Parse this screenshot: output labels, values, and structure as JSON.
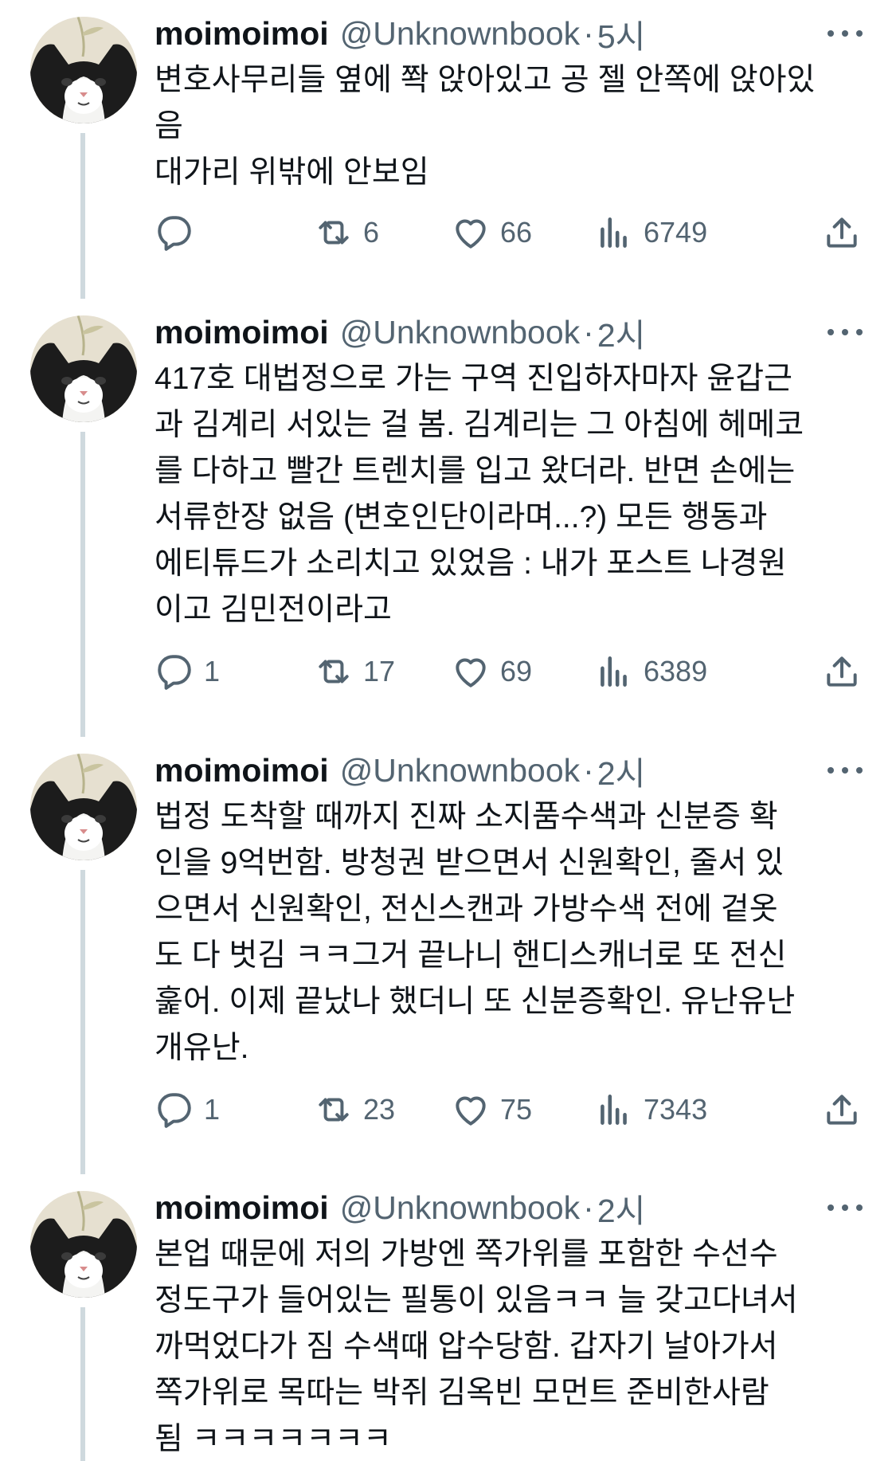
{
  "tweets": [
    {
      "name": "moimoimoi",
      "handle": "@Unknownbook",
      "separator": "·",
      "time": "5시",
      "lines": [
        "변호사무리들 옆에 쫙 앉아있고 공 젤 안쪽에 앉아있",
        "음",
        "대가리 위밖에 안보임"
      ],
      "replies": "",
      "retweets": "6",
      "likes": "66",
      "views": "6749"
    },
    {
      "name": "moimoimoi",
      "handle": "@Unknownbook",
      "separator": "·",
      "time": "2시",
      "lines": [
        "417호 대법정으로 가는 구역 진입하자마자 윤갑근",
        "과 김계리 서있는 걸 봄. 김계리는 그 아침에 헤메코",
        "를 다하고 빨간 트렌치를 입고 왔더라. 반면 손에는",
        "서류한장 없음 (변호인단이라며...?) 모든 행동과",
        "에티튜드가 소리치고 있었음 : 내가 포스트 나경원",
        "이고 김민전이라고"
      ],
      "replies": "1",
      "retweets": "17",
      "likes": "69",
      "views": "6389"
    },
    {
      "name": "moimoimoi",
      "handle": "@Unknownbook",
      "separator": "·",
      "time": "2시",
      "lines": [
        "법정 도착할 때까지 진짜 소지품수색과 신분증 확",
        "인을 9억번함. 방청권 받으면서 신원확인, 줄서 있",
        "으면서 신원확인, 전신스캔과 가방수색 전에 겉옷",
        "도 다 벗김 ㅋㅋ그거 끝나니 핸디스캐너로 또 전신",
        "훑어. 이제 끝났나 했더니 또 신분증확인. 유난유난",
        "개유난."
      ],
      "replies": "1",
      "retweets": "23",
      "likes": "75",
      "views": "7343"
    },
    {
      "name": "moimoimoi",
      "handle": "@Unknownbook",
      "separator": "·",
      "time": "2시",
      "lines": [
        "본업 때문에 저의 가방엔 쪽가위를 포함한 수선수",
        "정도구가 들어있는 필통이 있음ㅋㅋ 늘 갖고다녀서",
        "까먹었다가 짐 수색때 압수당함. 갑자기 날아가서",
        "쪽가위로 목따는 박쥐 김옥빈 모먼트 준비한사람",
        "됨 ㅋㅋㅋㅋㅋㅋㅋ"
      ],
      "replies": "",
      "retweets": "",
      "likes": "",
      "views": ""
    }
  ],
  "icons": {
    "avatar": "cat-avatar",
    "more": "more-dots-icon",
    "reply": "reply-icon",
    "retweet": "retweet-icon",
    "like": "heart-icon",
    "views": "views-bar-icon",
    "share": "share-icon"
  },
  "colors": {
    "text": "#0f1419",
    "secondary": "#536471",
    "thread_line": "#cfd9de",
    "background": "#ffffff"
  }
}
